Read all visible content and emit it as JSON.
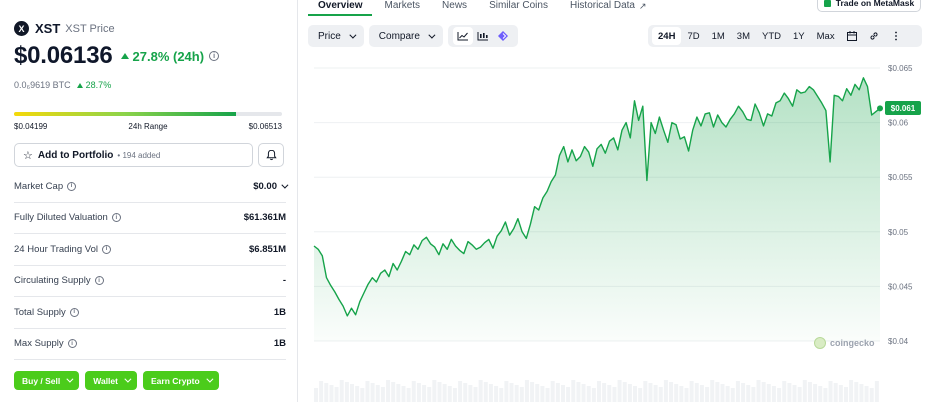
{
  "coin": {
    "logo_letter": "X",
    "symbol": "XST",
    "name": "XST Price",
    "price": "$0.06136",
    "change_24h": "27.8% (24h)",
    "btc_price": "0.0₆9619 BTC",
    "btc_change": "28.7%"
  },
  "range": {
    "low": "$0.04199",
    "label": "24h Range",
    "high": "$0.06513",
    "position": 0.83
  },
  "portfolio": {
    "label": "Add to Portfolio",
    "added": "• 194 added"
  },
  "stats": [
    {
      "label": "Market Cap",
      "value": "$0.00",
      "info": true,
      "dropdown": true
    },
    {
      "label": "Fully Diluted Valuation",
      "value": "$61.361M",
      "info": true,
      "dropdown": false
    },
    {
      "label": "24 Hour Trading Vol",
      "value": "$6.851M",
      "info": true,
      "dropdown": false
    },
    {
      "label": "Circulating Supply",
      "value": "-",
      "info": true,
      "dropdown": false
    },
    {
      "label": "Total Supply",
      "value": "1B",
      "info": true,
      "dropdown": false
    },
    {
      "label": "Max Supply",
      "value": "1B",
      "info": true,
      "dropdown": false
    }
  ],
  "actions": [
    "Buy / Sell",
    "Wallet",
    "Earn Crypto"
  ],
  "tabs": [
    "Overview",
    "Markets",
    "News",
    "Similar Coins",
    "Historical Data"
  ],
  "metamask": "Trade on MetaMask",
  "toolbar": {
    "price": "Price",
    "compare": "Compare"
  },
  "ranges": [
    "24H",
    "7D",
    "1M",
    "3M",
    "YTD",
    "1Y",
    "Max"
  ],
  "selected_range": "24H",
  "watermark": "coingecko",
  "colors": {
    "up": "#16a34a",
    "buttons": "#4bcc1b"
  },
  "chart_data": {
    "type": "area",
    "ylabels": [
      "$0.065",
      "$0.06",
      "$0.055",
      "$0.05",
      "$0.045",
      "$0.04"
    ],
    "yticks": [
      0.065,
      0.06,
      0.055,
      0.05,
      0.045,
      0.04
    ],
    "ylim": [
      0.04,
      0.065
    ],
    "current_label": "$0.061",
    "current_value": 0.0613,
    "grid": true,
    "values": [
      0.0487,
      0.0484,
      0.0478,
      0.0458,
      0.0451,
      0.0445,
      0.0438,
      0.0432,
      0.0423,
      0.043,
      0.0424,
      0.0436,
      0.0444,
      0.0452,
      0.0458,
      0.0454,
      0.0462,
      0.0465,
      0.0459,
      0.0471,
      0.0465,
      0.0473,
      0.0482,
      0.0479,
      0.0488,
      0.0484,
      0.0492,
      0.0495,
      0.0489,
      0.0486,
      0.0479,
      0.0489,
      0.0484,
      0.0493,
      0.0487,
      0.0483,
      0.048,
      0.0491,
      0.0488,
      0.0484,
      0.0486,
      0.049,
      0.0493,
      0.0485,
      0.0496,
      0.0501,
      0.0509,
      0.0497,
      0.0503,
      0.0512,
      0.05,
      0.0494,
      0.0507,
      0.0523,
      0.052,
      0.0531,
      0.0537,
      0.0546,
      0.0552,
      0.057,
      0.0578,
      0.0564,
      0.0575,
      0.0565,
      0.0569,
      0.0578,
      0.0573,
      0.056,
      0.0576,
      0.058,
      0.0572,
      0.0583,
      0.0586,
      0.0575,
      0.0593,
      0.06,
      0.0586,
      0.062,
      0.0602,
      0.0615,
      0.0547,
      0.06,
      0.059,
      0.0605,
      0.0593,
      0.0582,
      0.06,
      0.0598,
      0.0585,
      0.0587,
      0.0574,
      0.0593,
      0.0605,
      0.0597,
      0.0608,
      0.0609,
      0.0596,
      0.0607,
      0.06,
      0.0596,
      0.0603,
      0.0608,
      0.0615,
      0.061,
      0.0603,
      0.0602,
      0.0617,
      0.0609,
      0.0597,
      0.0608,
      0.0606,
      0.0618,
      0.062,
      0.0627,
      0.0622,
      0.0615,
      0.063,
      0.0627,
      0.0628,
      0.0633,
      0.063,
      0.0624,
      0.0618,
      0.0611,
      0.0564,
      0.0625,
      0.0624,
      0.062,
      0.0631,
      0.0625,
      0.0635,
      0.063,
      0.0641,
      0.0633,
      0.0607,
      0.061,
      0.0613
    ]
  }
}
